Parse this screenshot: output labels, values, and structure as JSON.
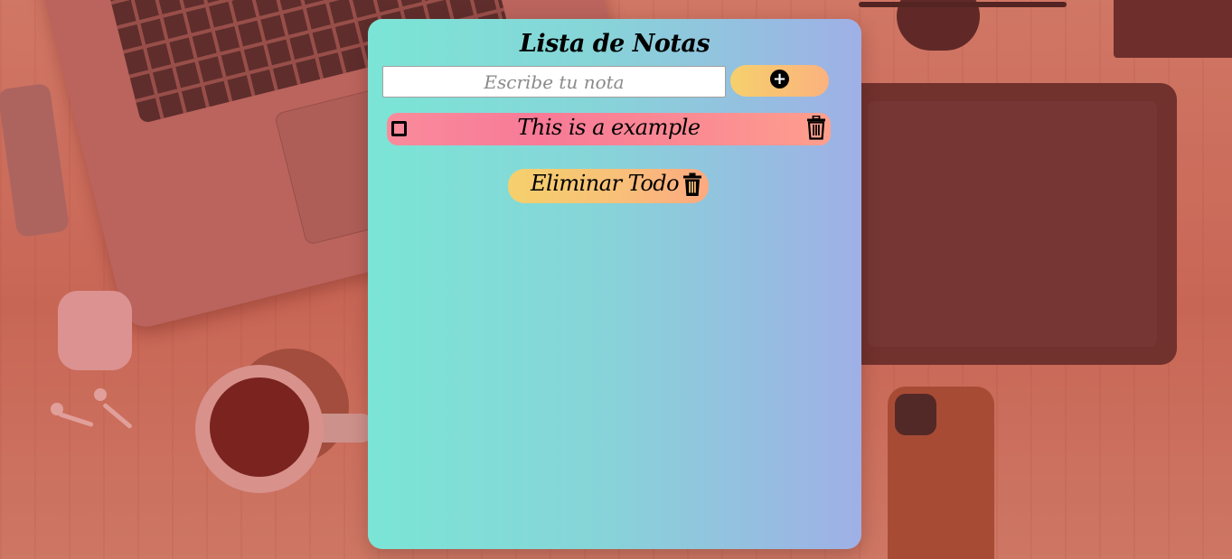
{
  "app": {
    "title": "Lista de Notas"
  },
  "form": {
    "input_placeholder": "Escribe tu nota",
    "input_value": "",
    "add_icon": "plus-circle-icon"
  },
  "notes": [
    {
      "text": "This is a example",
      "checked": false,
      "delete_icon": "trash-icon"
    }
  ],
  "actions": {
    "delete_all_label": "Eliminar Todo",
    "delete_all_icon": "trash-icon"
  },
  "colors": {
    "card_gradient_start": "#7be5d6",
    "card_gradient_end": "#9fb0e6",
    "accent_yellow": "#f6d06d",
    "accent_orange": "#fbb27e",
    "note_pink": "#f87a97",
    "background_overlay": "#c9705e"
  }
}
